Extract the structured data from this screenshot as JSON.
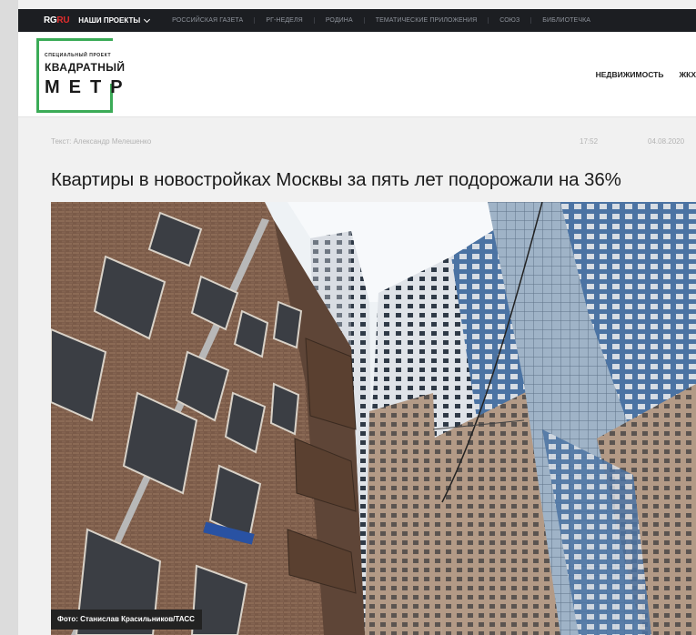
{
  "topbar": {
    "logo_rg": "RG",
    "logo_ru": "RU",
    "projects_label": "НАШИ ПРОЕКТЫ",
    "links": [
      "РОССИЙСКАЯ ГАЗЕТА",
      "РГ-НЕДЕЛЯ",
      "РОДИНА",
      "ТЕМАТИЧЕСКИЕ ПРИЛОЖЕНИЯ",
      "СОЮЗ",
      "БИБЛИОТЕЧКА"
    ]
  },
  "brand": {
    "line1": "СПЕЦИАЛЬНЫЙ ПРОЕКТ",
    "line2": "КВАДРАТНЫЙ",
    "line3": "МЕТР",
    "accent_color": "#3bab57"
  },
  "header_nav": [
    "НЕДВИЖИМОСТЬ",
    "ЖКХ"
  ],
  "article": {
    "author": "Текст: Александр Мелешенко",
    "time": "17:52",
    "date": "04.08.2020",
    "title": "Квартиры в новостройках Москвы за пять лет подорожали на 36%",
    "photo_caption": "Фото: Станислав Красильников/ТАСС"
  }
}
